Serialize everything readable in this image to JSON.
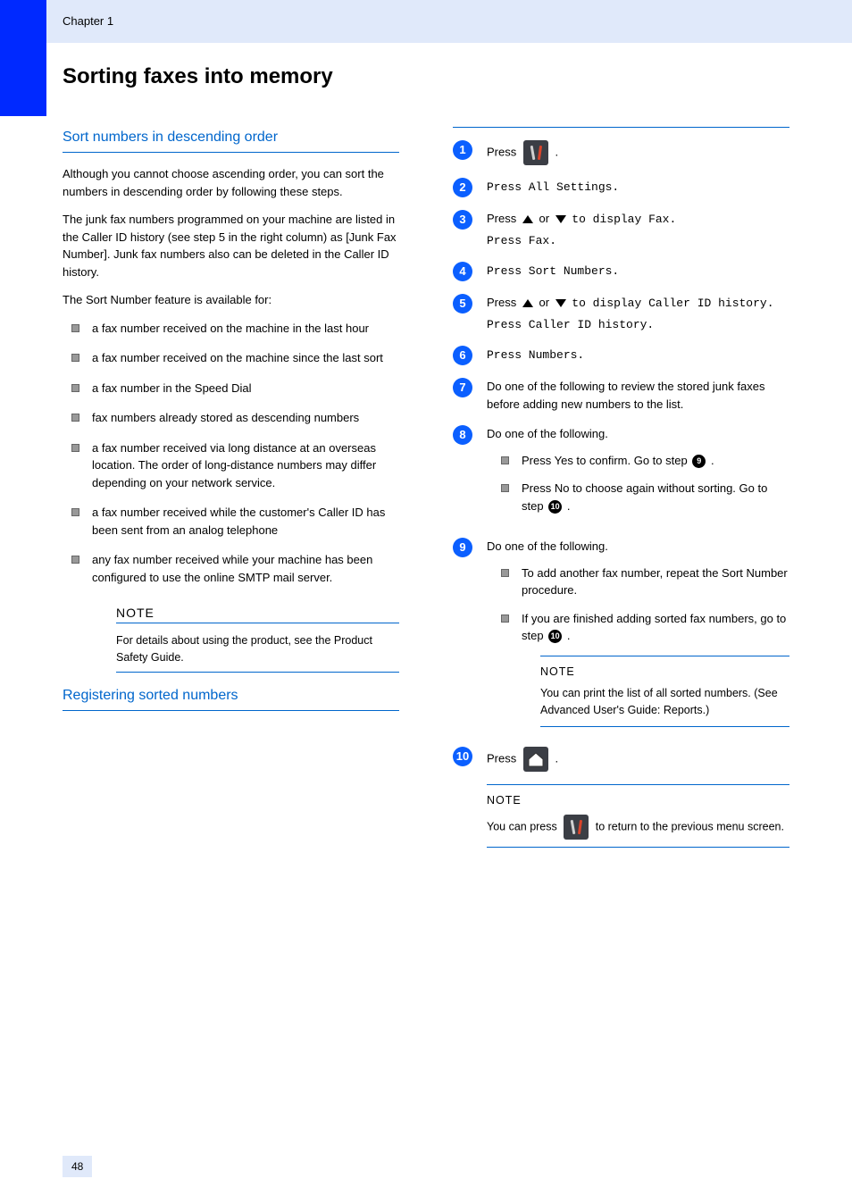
{
  "header": {
    "chapter": "Chapter 1"
  },
  "title": "Sorting faxes into memory",
  "left": {
    "intro_heading": "Sort numbers in descending order",
    "intro_p1": "Although you cannot choose ascending order, you can sort the numbers in descending order by following these steps.",
    "intro_p2": "The junk fax numbers programmed on your machine are listed in the Caller ID history (see step 5 in the right column) as [Junk Fax Number]. Junk fax numbers also can be deleted in the Caller ID history.",
    "intro_p3": "The Sort Number feature is available for:",
    "features": [
      "a fax number received on the machine in the last hour",
      "a fax number received on the machine since the last sort",
      "a fax number in the Speed Dial",
      "fax numbers already stored as descending numbers",
      "a fax number received via long distance at an overseas location. The order of long-distance numbers may differ depending on your network service.",
      "a fax number received while the customer's Caller ID has been sent from an analog telephone",
      "any fax number received while your machine has been configured to use the online SMTP mail server."
    ],
    "note_label": "NOTE",
    "note_body": "For details about using the product, see the Product Safety Guide.",
    "reg_heading": "Registering sorted numbers"
  },
  "right": {
    "steps": [
      {
        "n": "1",
        "body_pre": "Press ",
        "body_post": "."
      },
      {
        "n": "2",
        "body": "Press All Settings."
      },
      {
        "n": "3",
        "body_pre": "Press ",
        "tri": true,
        "body_mid1": " or ",
        "body_mid2": " to display Fax.",
        "extra": "Press Fax."
      },
      {
        "n": "4",
        "body": "Press Sort Numbers."
      },
      {
        "n": "5",
        "body_pre": "Press ",
        "tri": true,
        "body_mid1": " or ",
        "body_mid2": " to display Caller ID history.",
        "extra": "Press Caller ID history."
      },
      {
        "n": "6",
        "body": "Press Numbers."
      },
      {
        "n": "7",
        "body": "Do one of the following to review the stored junk faxes before adding new numbers to the list."
      },
      {
        "n": "8",
        "body": "Do one of the following.",
        "subs": [
          {
            "pre": "Press Yes to confirm. Go to step ",
            "ref": "9",
            "post": "."
          },
          {
            "pre": "Press No to choose again without sorting. Go to step ",
            "ref": "10",
            "post": "."
          }
        ]
      },
      {
        "n": "9",
        "body": "Do one of the following.",
        "subs": [
          {
            "pre": "To add another fax number, repeat the Sort Number procedure."
          },
          {
            "pre": "If you are finished adding sorted fax numbers, go to step ",
            "ref": "10",
            "post": "."
          }
        ],
        "note_label": "NOTE",
        "note_body": "You can print the list of all sorted numbers. (See Advanced User's Guide: Reports.)"
      },
      {
        "n": "10",
        "body_pre": "Press ",
        "home": true,
        "body_post": ".",
        "note_label": "NOTE",
        "note_body_pre": "You can press ",
        "note_body_post": " to return to the previous menu screen."
      }
    ]
  },
  "page_number": "48"
}
